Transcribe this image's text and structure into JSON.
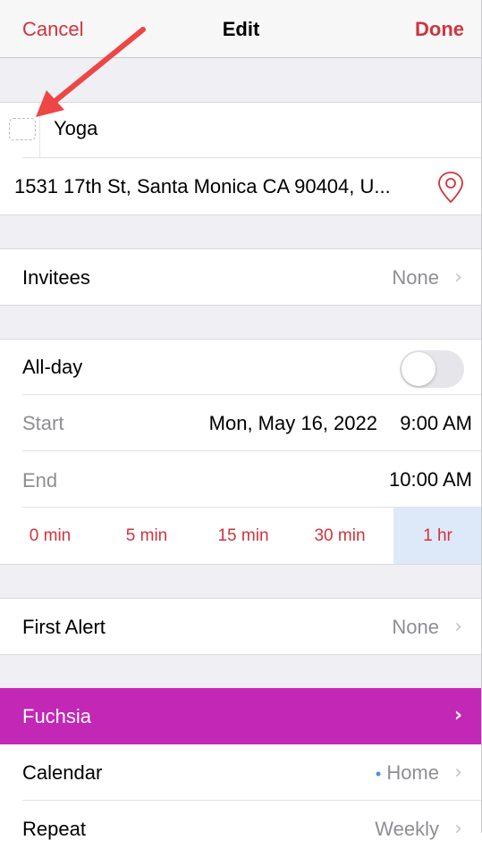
{
  "nav": {
    "cancel": "Cancel",
    "title": "Edit",
    "done": "Done"
  },
  "event": {
    "title": "Yoga",
    "location": "1531 17th St, Santa Monica CA 90404, U..."
  },
  "invitees": {
    "label": "Invitees",
    "value": "None"
  },
  "allday": {
    "label": "All-day",
    "on": false
  },
  "start": {
    "label": "Start",
    "date": "Mon, May 16, 2022",
    "time": "9:00 AM"
  },
  "end": {
    "label": "End",
    "time": "10:00 AM"
  },
  "durations": [
    "0 min",
    "5 min",
    "15 min",
    "30 min",
    "1 hr"
  ],
  "selected_duration": "1 hr",
  "first_alert": {
    "label": "First Alert",
    "value": "None"
  },
  "color": {
    "label": "Fuchsia",
    "hex": "#c327b6"
  },
  "calendar": {
    "label": "Calendar",
    "value": "Home",
    "dot": "•"
  },
  "repeat": {
    "label": "Repeat",
    "value": "Weekly"
  },
  "accent": "#d0343e"
}
